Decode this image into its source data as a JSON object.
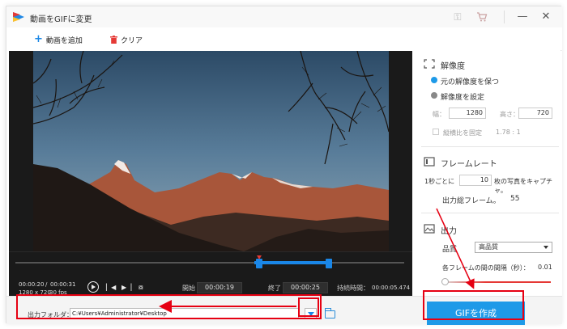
{
  "window": {
    "title": "動画をGIFに変更"
  },
  "titlebar": {
    "key_icon": "key-icon",
    "cart_icon": "cart-icon",
    "minimize": "—",
    "close": "✕"
  },
  "toolbar": {
    "add_video": "動画を追加",
    "clear": "クリア"
  },
  "player": {
    "current_time": "00:00:20",
    "time_separator": "/",
    "total_time": "00:00:31",
    "resolution": "1280 x 720",
    "fps": "30 fps",
    "start_label": "開始",
    "start_time": "00:00:19",
    "end_label": "終了",
    "end_time": "00:00:25",
    "duration_label": "持続時間：",
    "duration_value": "00:00:05.474"
  },
  "resolution_section": {
    "title": "解像度",
    "keep_original": "元の解像度を保つ",
    "set_resolution": "解像度を設定",
    "width_label": "幅：",
    "width_value": "1280",
    "height_label": "高さ：",
    "height_value": "720",
    "aspect_label": "縦横比を固定",
    "aspect_value": "1.78 : 1"
  },
  "framerate_section": {
    "title": "フレームレート",
    "per_second_prefix": "1秒ごとに",
    "frames_value": "10",
    "per_second_suffix": "枚の写真をキャプチャ。",
    "total_frames_label": "出力総フレーム。",
    "total_frames_value": "55"
  },
  "output_section": {
    "title": "出力",
    "quality_label": "品質",
    "quality_value": "高品質",
    "interval_label": "各フレームの間の間隔（秒）：",
    "interval_value": "0.01"
  },
  "bottom": {
    "output_folder_label": "出力フォルダ：",
    "output_path": "C:¥Users¥Administrator¥Desktop",
    "create_button": "GIFを作成"
  },
  "colors": {
    "accent": "#1e9ae8",
    "annotation": "#e60012"
  }
}
